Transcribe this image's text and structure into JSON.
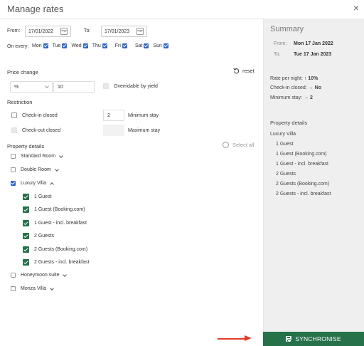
{
  "dialog": {
    "title": "Manage rates",
    "close_icon": "×"
  },
  "dates": {
    "from_label": "From:",
    "from_value": "17/01/2022",
    "to_label": "To:",
    "to_value": "17/01/2023"
  },
  "days": {
    "label": "On every:",
    "items": [
      {
        "label": "Mon",
        "checked": true
      },
      {
        "label": "Tue",
        "checked": true
      },
      {
        "label": "Wed",
        "checked": true
      },
      {
        "label": "Thu",
        "checked": true
      },
      {
        "label": "Fri",
        "checked": true
      },
      {
        "label": "Sat",
        "checked": true
      },
      {
        "label": "Sun",
        "checked": true
      }
    ]
  },
  "price_change": {
    "heading": "Price change",
    "reset_label": "reset",
    "type_value": "%",
    "amount_value": "10",
    "overridable_label": "Overridable by yield"
  },
  "restriction": {
    "heading": "Restriction",
    "checkin_closed_label": "Check-in closed",
    "checkout_closed_label": "Check-out closed",
    "min_stay_value": "2",
    "min_stay_label": "Minimum stay",
    "max_stay_value": "",
    "max_stay_label": "Maximum stay"
  },
  "property": {
    "heading": "Property details",
    "select_all_label": "Select all",
    "rooms": [
      {
        "label": "Standard Room",
        "checked": false,
        "expanded": false
      },
      {
        "label": "Double Room",
        "checked": false,
        "expanded": false
      },
      {
        "label": "Luxury Villa",
        "checked": true,
        "expanded": true
      },
      {
        "label": "Honeymoon suite",
        "checked": false,
        "expanded": false
      },
      {
        "label": "Monza Villa",
        "checked": false,
        "expanded": false
      }
    ],
    "villa_rates": [
      "1 Guest",
      "1 Guest (Booking.com)",
      "1 Guest - incl. breakfast",
      "2 Guests",
      "2 Guests (Booking.com)",
      "2 Guests - incl. breakfast"
    ]
  },
  "summary": {
    "title": "Summary",
    "from_label": "From:",
    "from_value": "Mon 17 Jan 2022",
    "to_label": "To:",
    "to_value": "Tue 17 Jan 2023",
    "rate_label": "Rate per night:",
    "rate_value": "↑ 10%",
    "checkin_label": "Check-in closed:",
    "checkin_value": "→ No",
    "minstay_label": "Minimum stay:",
    "minstay_value": "→ 2",
    "property_heading": "Property details",
    "property_name": "Luxury Villa",
    "rates": [
      "1 Guest",
      "1 Guest (Booking.com)",
      "1 Guest - incl. breakfast",
      "2 Guests",
      "2 Guests (Booking.com)",
      "2 Guests - incl. breakfast"
    ]
  },
  "synchronise": {
    "label": "SYNCHRONISE",
    "icon": "save-icon"
  },
  "colors": {
    "accent_green": "#26704a",
    "checkbox_blue": "#2f66c5",
    "arrow_red": "#e53a2b",
    "sidebar_bg": "#efefef"
  }
}
